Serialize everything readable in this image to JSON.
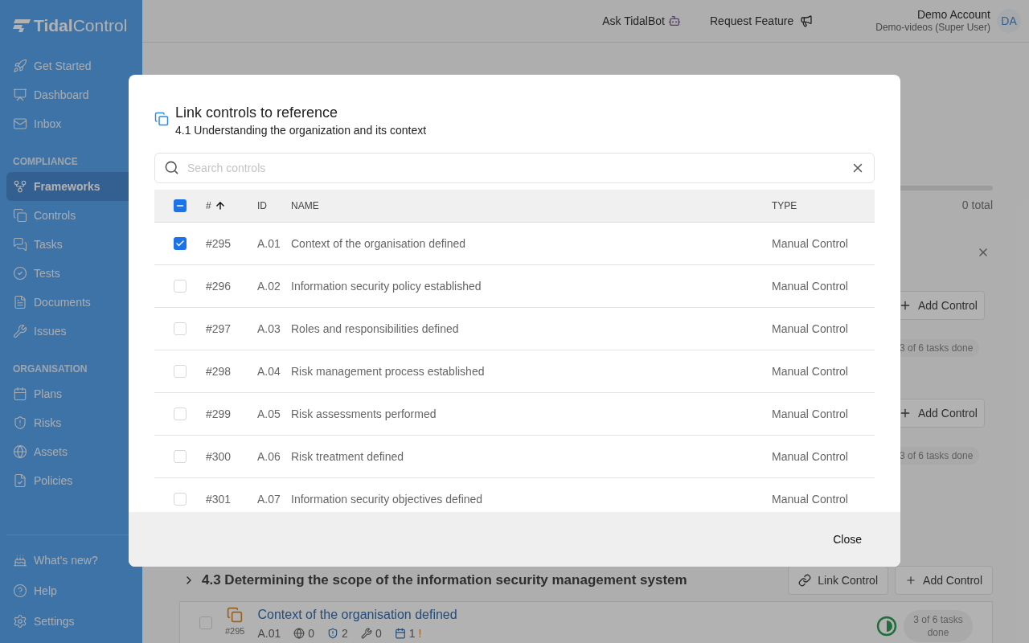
{
  "sidebar": {
    "logo": {
      "bold": "Tidal",
      "light": "Control"
    },
    "sections": [
      {
        "items": [
          {
            "label": "Get Started",
            "selected": false
          },
          {
            "label": "Dashboard",
            "selected": false
          },
          {
            "label": "Inbox",
            "selected": false
          }
        ]
      },
      {
        "heading": "COMPLIANCE",
        "items": [
          {
            "label": "Frameworks",
            "selected": true
          },
          {
            "label": "Controls",
            "selected": false
          },
          {
            "label": "Tasks",
            "selected": false
          },
          {
            "label": "Tests",
            "selected": false
          },
          {
            "label": "Documents",
            "selected": false
          },
          {
            "label": "Issues",
            "selected": false
          }
        ]
      },
      {
        "heading": "ORGANISATION",
        "items": [
          {
            "label": "Plans",
            "selected": false
          },
          {
            "label": "Risks",
            "selected": false
          },
          {
            "label": "Assets",
            "selected": false
          },
          {
            "label": "Policies",
            "selected": false
          }
        ]
      }
    ],
    "footer_items": [
      {
        "label": "What's new?"
      },
      {
        "label": "Help"
      },
      {
        "label": "Settings"
      }
    ]
  },
  "header": {
    "ask_bot": "Ask TidalBot",
    "request_feature": "Request Feature",
    "account_name": "Demo Account",
    "account_role": "Demo-videos (Super User)",
    "avatar": "DA"
  },
  "background": {
    "total": "0 total",
    "groups": [
      {
        "add_control": "Add Control",
        "tasks": "3 of 6 tasks done"
      },
      {
        "add_control": "Add Control",
        "tasks": "3 of 6 tasks done"
      }
    ],
    "section": {
      "title": "4.3 Determining the scope of the information security management system",
      "link_control": "Link Control",
      "add_control": "Add Control",
      "card": {
        "checked": false,
        "title": "Context of the organisation defined",
        "number": "#295",
        "id": "A.01",
        "counts": [
          "0",
          "2",
          "0",
          "1"
        ],
        "warning": "!",
        "tasks": "3 of 6 tasks done"
      }
    }
  },
  "modal": {
    "title": "Link controls to reference",
    "subtitle": "4.1 Understanding the organization and its context",
    "search": {
      "placeholder": "Search controls"
    },
    "select_all": {
      "partial": true
    },
    "columns": [
      {
        "label": "#",
        "sorted": true
      },
      {
        "label": "ID",
        "sorted": false
      },
      {
        "label": "NAME",
        "sorted": false
      },
      {
        "label": "TYPE",
        "sorted": false
      }
    ],
    "rows": [
      {
        "number": "#295",
        "id": "A.01",
        "name": "Context of the organisation defined",
        "type": "Manual Control",
        "checked": true
      },
      {
        "number": "#296",
        "id": "A.02",
        "name": "Information security policy established",
        "type": "Manual Control",
        "checked": false
      },
      {
        "number": "#297",
        "id": "A.03",
        "name": "Roles and responsibilities defined",
        "type": "Manual Control",
        "checked": false
      },
      {
        "number": "#298",
        "id": "A.04",
        "name": "Risk management process established",
        "type": "Manual Control",
        "checked": false
      },
      {
        "number": "#299",
        "id": "A.05",
        "name": "Risk assessments performed",
        "type": "Manual Control",
        "checked": false
      },
      {
        "number": "#300",
        "id": "A.06",
        "name": "Risk treatment defined",
        "type": "Manual Control",
        "checked": false
      },
      {
        "number": "#301",
        "id": "A.07",
        "name": "Information security objectives defined",
        "type": "Manual Control",
        "checked": false
      }
    ],
    "close": "Close"
  }
}
